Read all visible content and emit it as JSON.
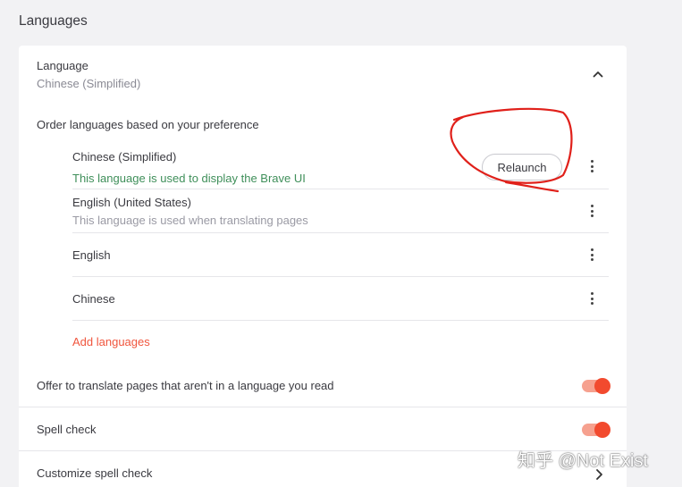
{
  "section": {
    "title": "Languages"
  },
  "language": {
    "title": "Language",
    "current": "Chinese (Simplified)"
  },
  "order": {
    "label": "Order languages based on your preference",
    "items": [
      {
        "name": "Chinese (Simplified)",
        "desc": "This language is used to display the Brave UI",
        "action": "Relaunch"
      },
      {
        "name": "English (United States)",
        "desc": "This language is used when translating pages"
      },
      {
        "name": "English"
      },
      {
        "name": "Chinese"
      }
    ],
    "add_label": "Add languages"
  },
  "translate": {
    "label": "Offer to translate pages that aren't in a language you read",
    "enabled": true
  },
  "spellcheck": {
    "label": "Spell check",
    "enabled": true
  },
  "customize_spell": {
    "label": "Customize spell check"
  },
  "watermark": "知乎 @Not Exist",
  "colors": {
    "accent": "#f24a2e",
    "link": "#f0563e",
    "ui_desc_green": "#3f8f5a",
    "annotation_red": "#e0201a"
  },
  "icons": [
    "chevron-up-icon",
    "more-vert-icon",
    "chevron-right-icon"
  ]
}
